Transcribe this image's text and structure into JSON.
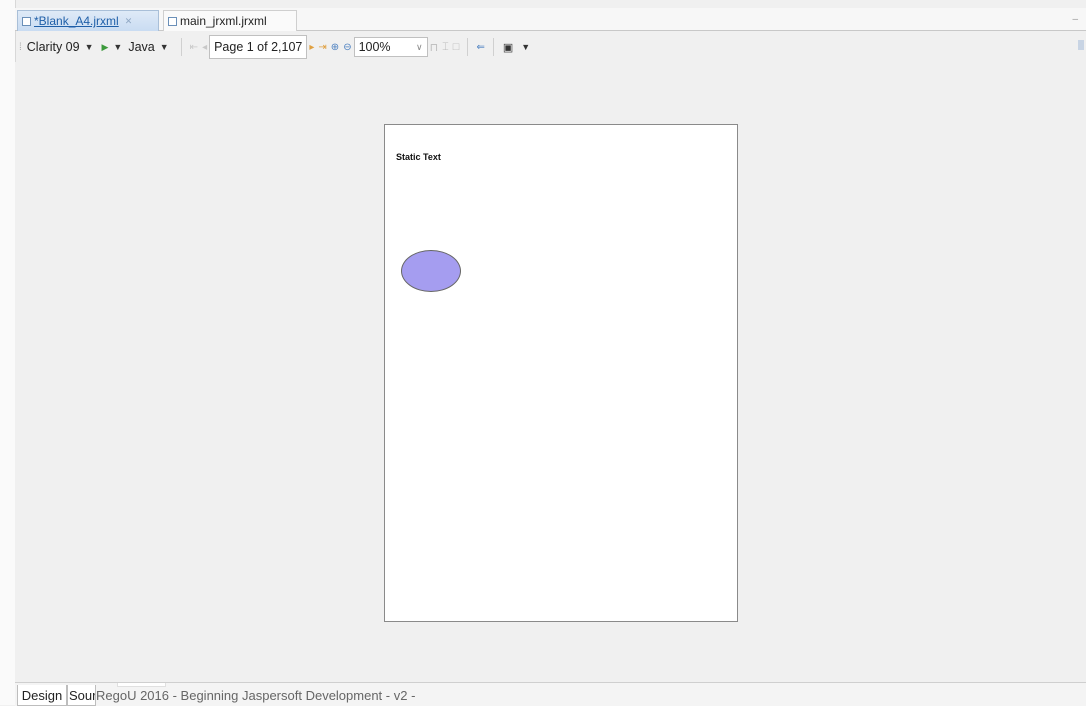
{
  "editor_tabs": [
    {
      "label": "*Blank_A4.jrxml",
      "active": true
    },
    {
      "label": "main_jrxml.jrxml",
      "active": false
    }
  ],
  "toolbar": {
    "adapter": "Clarity 09",
    "language": "Java",
    "page_status": "Page 1 of 2,107",
    "zoom": "100%"
  },
  "report": {
    "static_text": "Static Text",
    "ellipse_color": "#a59df0"
  },
  "bottom_tabs": {
    "design": "Design",
    "source": "Source"
  },
  "caption": "RegoU 2016 - Beginning Jaspersoft Development - v2 -"
}
